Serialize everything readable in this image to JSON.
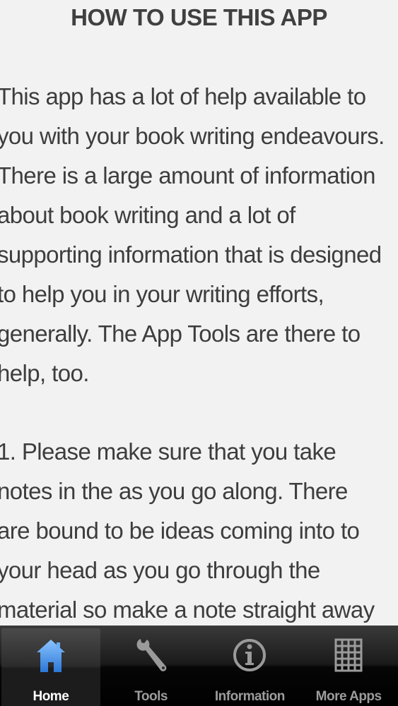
{
  "page": {
    "heading": "HOW TO USE THIS APP",
    "paragraphs": [
      "This app has a lot of help available to\nyou with your book writing endeavours.\nThere is a large amount of information\nabout book writing and a lot of\nsupporting information that is designed\nto help you in your writing efforts,\ngenerally. The App Tools are there to\nhelp, too.",
      "1. Please make sure that you take\nnotes in the as you go along. There\nare bound to be ideas coming into to\nyour head as you go through the\nmaterial so make a note straight away"
    ]
  },
  "tabbar": {
    "active_index": 0,
    "accent": "#3b8ee8",
    "tabs": [
      {
        "label": "Home",
        "icon": "home-icon"
      },
      {
        "label": "Tools",
        "icon": "wrench-icon"
      },
      {
        "label": "Information",
        "icon": "info-icon"
      },
      {
        "label": "More Apps",
        "icon": "grid-icon"
      }
    ]
  }
}
